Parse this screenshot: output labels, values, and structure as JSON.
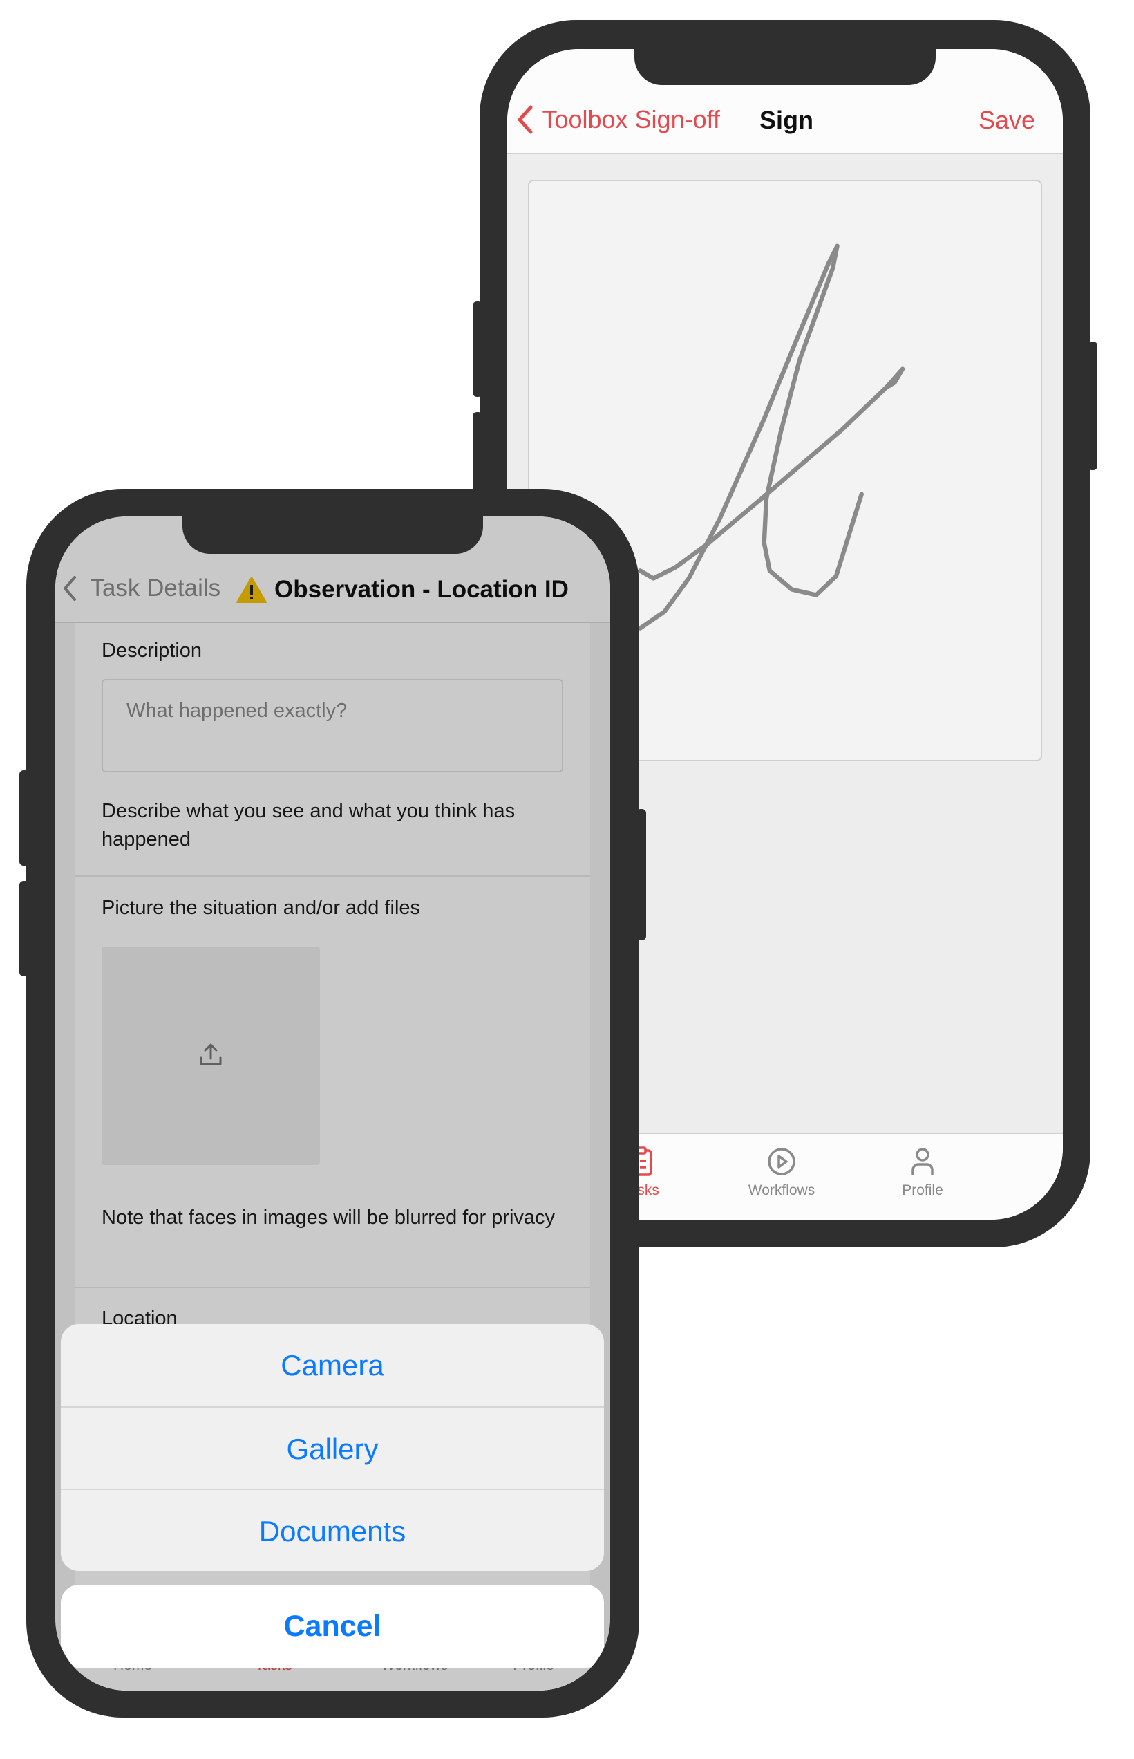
{
  "back_phone": {
    "nav": {
      "back_label": "Toolbox Sign-off",
      "title": "Sign",
      "save_label": "Save"
    },
    "tabs": [
      {
        "label": "Tasks",
        "icon": "clipboard-list-icon",
        "active": true
      },
      {
        "label": "Workflows",
        "icon": "play-circle-icon",
        "active": false
      },
      {
        "label": "Profile",
        "icon": "person-icon",
        "active": false
      }
    ]
  },
  "front_phone": {
    "nav": {
      "back_label": "Task Details",
      "icon": "warning-icon",
      "title": "Observation - Location ID"
    },
    "description": {
      "label": "Description",
      "placeholder": "What happened exactly?",
      "helper": "Describe what you see and what you think has happened"
    },
    "files": {
      "label": "Picture the situation and/or add files",
      "upload_icon": "upload-icon",
      "note": "Note that faces in images will be blurred for privacy"
    },
    "location_label": "Location",
    "tabs": [
      "Home",
      "Tasks",
      "Workflows",
      "Profile"
    ],
    "action_sheet": {
      "options": [
        "Camera",
        "Gallery",
        "Documents"
      ],
      "cancel": "Cancel"
    }
  },
  "colors": {
    "accent_red": "#e5484d",
    "ios_blue": "#0a7aff",
    "device": "#2f2f2f"
  }
}
